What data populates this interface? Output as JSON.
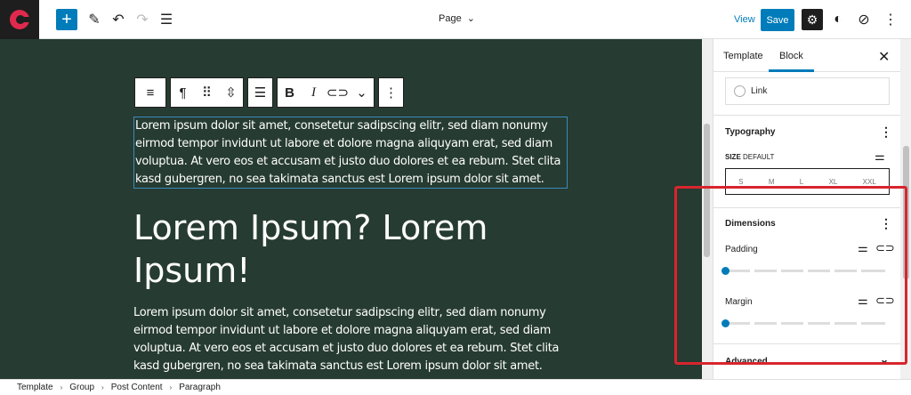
{
  "topbar": {
    "page_label": "Page",
    "view_label": "View",
    "save_label": "Save"
  },
  "canvas": {
    "paragraph1": "Lorem ipsum dolor sit amet, consetetur sadipscing elitr, sed diam nonumy eirmod tempor invidunt ut labore et dolore magna aliquyam erat, sed diam voluptua. At vero eos et accusam et justo duo dolores et ea rebum. Stet clita kasd gubergren, no sea takimata sanctus est Lorem ipsum dolor sit amet.",
    "heading": "Lorem Ipsum? Lorem Ipsum!",
    "paragraph2": "Lorem ipsum dolor sit amet, consetetur sadipscing elitr, sed diam nonumy eirmod tempor invidunt ut labore et dolore magna aliquyam erat, sed diam voluptua. At vero eos et accusam et justo duo dolores et ea rebum. Stet clita kasd gubergren, no sea takimata sanctus est Lorem ipsum dolor sit amet.",
    "background_color": "#263b31"
  },
  "sidebar": {
    "tabs": [
      "Template",
      "Block"
    ],
    "link_label": "Link",
    "typography": {
      "title": "Typography",
      "size_label": "SIZE",
      "size_value": "DEFAULT",
      "sizes": [
        "S",
        "M",
        "L",
        "XL",
        "XXL"
      ]
    },
    "dimensions": {
      "title": "Dimensions",
      "padding_label": "Padding",
      "margin_label": "Margin",
      "padding_value": 0,
      "margin_value": 0
    },
    "advanced_label": "Advanced"
  },
  "footer": {
    "breadcrumbs": [
      "Template",
      "Group",
      "Post Content",
      "Paragraph"
    ]
  },
  "colors": {
    "accent": "#007cba",
    "highlight": "#d8252e",
    "brand": "#e02a4d"
  }
}
